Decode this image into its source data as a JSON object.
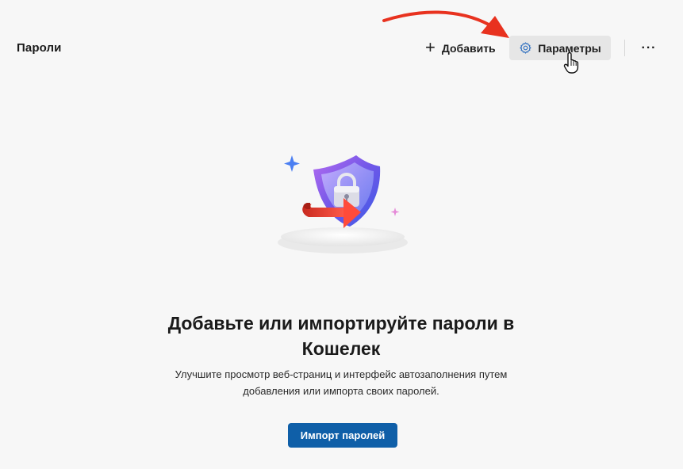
{
  "header": {
    "title": "Пароли",
    "add_label": "Добавить",
    "settings_label": "Параметры",
    "more_label": "···"
  },
  "empty_state": {
    "heading_line1": "Добавьте или импортируйте пароли в",
    "heading_line2": "Кошелек",
    "description_line1": "Улучшите просмотр веб-страниц и интерфейс автозаполнения путем",
    "description_line2": "добавления или импорта своих паролей.",
    "import_button_label": "Импорт паролей"
  },
  "icons": {
    "add": "plus-icon",
    "settings": "gear-icon",
    "more": "more-horizontal-icon",
    "illustration": "shield-lock-import-illustration",
    "annotation": "red-arrow-annotation",
    "cursor": "hand-pointer-cursor"
  },
  "colors": {
    "background": "#f7f7f7",
    "settings_button_bg": "#e6e6e6",
    "primary_button": "#0f5fa8",
    "annotation_arrow": "#e8321f",
    "gear_icon": "#2f6fbf"
  }
}
